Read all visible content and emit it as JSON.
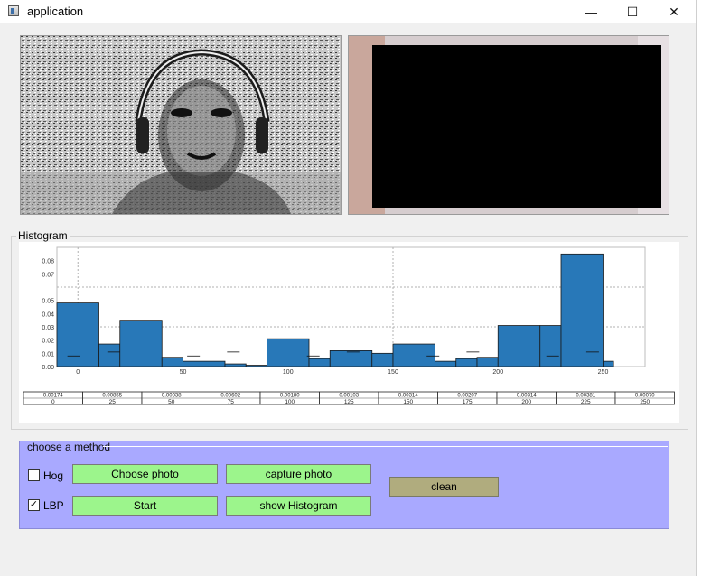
{
  "window": {
    "title": "application",
    "minimize": "—",
    "maximize": "☐",
    "close": "✕"
  },
  "images": {
    "left_icon": "lbp-face-image",
    "right_icon": "camera-feed-image"
  },
  "histogram": {
    "group_title": "Histogram",
    "table_values": [
      "0.00174",
      "0.00855",
      "0.00038",
      "0.00602",
      "0.00180",
      "0.00103",
      "0.00314",
      "0.00207",
      "0.00314",
      "0.00381",
      "0.00070"
    ],
    "table_labels": [
      "0",
      "25",
      "50",
      "75",
      "100",
      "125",
      "150",
      "175",
      "200",
      "225",
      "250"
    ],
    "bar_color": "#2878b8"
  },
  "chart_data": {
    "type": "bar",
    "title": "",
    "xlabel": "",
    "ylabel": "",
    "xlim": [
      -10,
      270
    ],
    "ylim": [
      0,
      0.09
    ],
    "grid": true,
    "ytick_labels": [
      "0.00",
      "0.01",
      "0.02",
      "0.03",
      "0.04",
      "0.05",
      "0.07",
      "0.08"
    ],
    "xtick_labels": [
      "0",
      "50",
      "100",
      "150",
      "200",
      "250"
    ],
    "bars": [
      {
        "x0": -10,
        "x1": 10,
        "value": 0.048
      },
      {
        "x0": 10,
        "x1": 20,
        "value": 0.017
      },
      {
        "x0": 20,
        "x1": 40,
        "value": 0.035
      },
      {
        "x0": 40,
        "x1": 50,
        "value": 0.007
      },
      {
        "x0": 50,
        "x1": 70,
        "value": 0.004
      },
      {
        "x0": 70,
        "x1": 80,
        "value": 0.002
      },
      {
        "x0": 80,
        "x1": 90,
        "value": 0.001
      },
      {
        "x0": 90,
        "x1": 110,
        "value": 0.021
      },
      {
        "x0": 110,
        "x1": 120,
        "value": 0.006
      },
      {
        "x0": 120,
        "x1": 140,
        "value": 0.012
      },
      {
        "x0": 140,
        "x1": 150,
        "value": 0.01
      },
      {
        "x0": 150,
        "x1": 170,
        "value": 0.017
      },
      {
        "x0": 170,
        "x1": 180,
        "value": 0.004
      },
      {
        "x0": 180,
        "x1": 190,
        "value": 0.006
      },
      {
        "x0": 190,
        "x1": 200,
        "value": 0.007
      },
      {
        "x0": 200,
        "x1": 220,
        "value": 0.031
      },
      {
        "x0": 220,
        "x1": 230,
        "value": 0.031
      },
      {
        "x0": 230,
        "x1": 250,
        "value": 0.085
      },
      {
        "x0": 250,
        "x1": 255,
        "value": 0.004
      }
    ]
  },
  "method": {
    "group_title": "choose a method",
    "hog_label": "Hog",
    "hog_checked": false,
    "lbp_label": "LBP",
    "lbp_checked": true,
    "check_mark": "✓",
    "choose_photo": "Choose photo",
    "capture_photo": "capture photo",
    "start": "Start",
    "show_histogram": "show Histogram",
    "clean": "clean"
  }
}
